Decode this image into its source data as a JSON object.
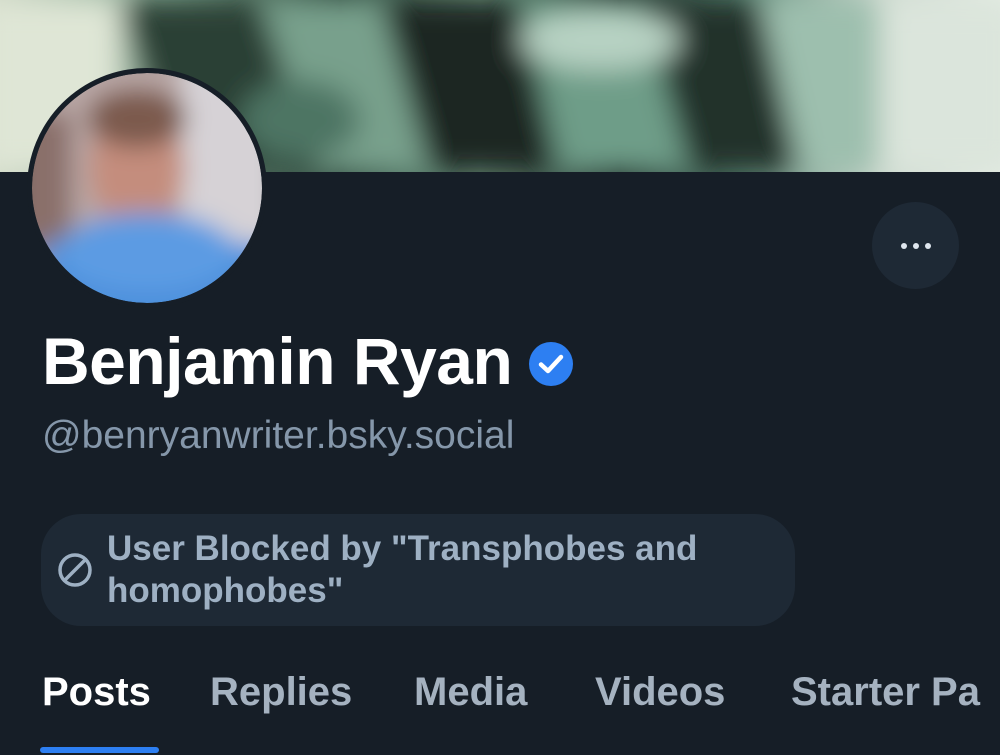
{
  "profile": {
    "display_name": "Benjamin Ryan",
    "handle": "@benryanwriter.bsky.social",
    "verified": true
  },
  "moderation": {
    "blocked_label": "User Blocked by \"Transphobes and homophobes\""
  },
  "tabs": [
    {
      "label": "Posts",
      "active": true
    },
    {
      "label": "Replies",
      "active": false
    },
    {
      "label": "Media",
      "active": false
    },
    {
      "label": "Videos",
      "active": false
    },
    {
      "label": "Starter Pa",
      "active": false
    }
  ],
  "colors": {
    "background": "#161e27",
    "pill_background": "#1e2935",
    "accent": "#2d7ff2",
    "handle": "#8597aa",
    "verified": "#2d7ff2"
  },
  "icons": {
    "verified": "verified-check-icon",
    "more": "more-options-icon",
    "blocked": "block-icon"
  }
}
